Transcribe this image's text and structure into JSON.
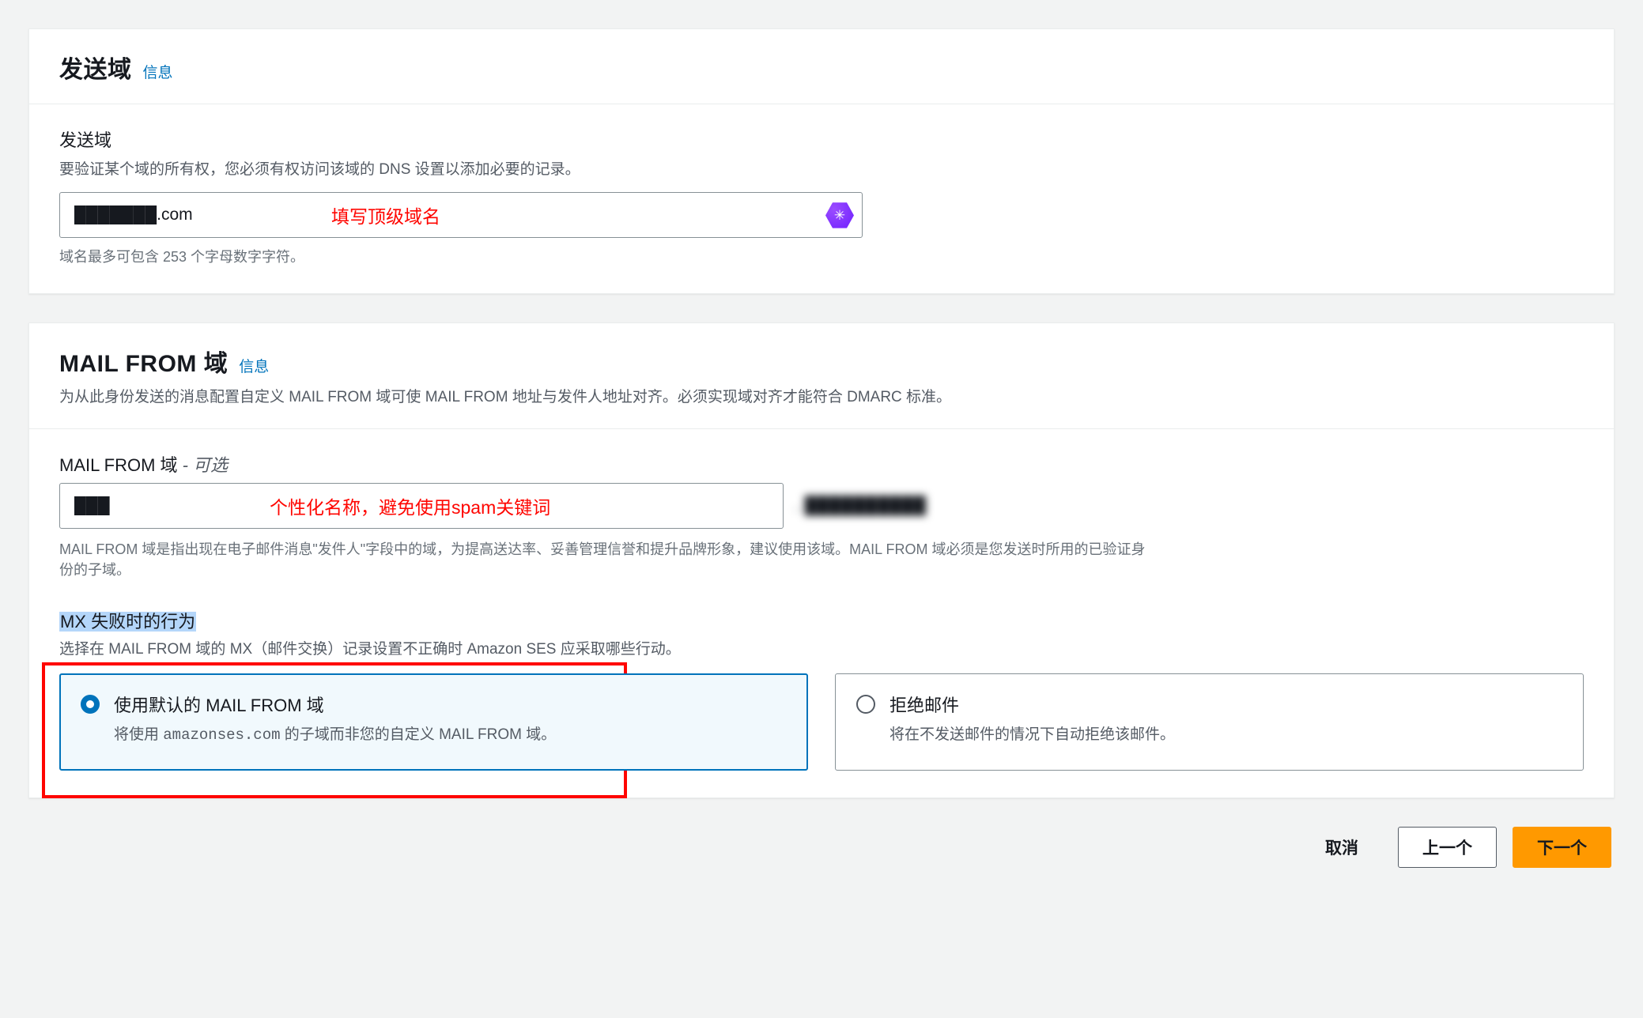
{
  "panel1": {
    "title": "发送域",
    "info": "信息",
    "label": "发送域",
    "hint": "要验证某个域的所有权，您必须有权访问该域的 DNS 设置以添加必要的记录。",
    "input_value": "███████.com",
    "helper": "域名最多可包含 253 个字母数字字符。",
    "annotation": "填写顶级域名"
  },
  "panel2": {
    "title": "MAIL FROM 域",
    "info": "信息",
    "subtext": "为从此身份发送的消息配置自定义 MAIL FROM 域可使 MAIL FROM 地址与发件人地址对齐。必须实现域对齐才能符合 DMARC 标准。",
    "label_main": "MAIL FROM 域",
    "label_optional": " - 可选",
    "mailfrom_value": "███",
    "mailfrom_suffix": ". ██████████",
    "annotation": "个性化名称，避免使用spam关键词",
    "helper": "MAIL FROM 域是指出现在电子邮件消息\"发件人\"字段中的域，为提高送达率、妥善管理信誉和提升品牌形象，建议使用该域。MAIL FROM 域必须是您发送时所用的已验证身份的子域。",
    "mx_label": "MX 失败时的行为",
    "mx_hint": "选择在 MAIL FROM 域的 MX（邮件交换）记录设置不正确时 Amazon SES 应采取哪些行动。",
    "radio1_title": "使用默认的 MAIL FROM 域",
    "radio1_desc_a": "将使用 ",
    "radio1_desc_b": "amazonses.com",
    "radio1_desc_c": " 的子域而非您的自定义 MAIL FROM 域。",
    "radio2_title": "拒绝邮件",
    "radio2_desc": "将在不发送邮件的情况下自动拒绝该邮件。"
  },
  "footer": {
    "cancel": "取消",
    "prev": "上一个",
    "next": "下一个"
  }
}
